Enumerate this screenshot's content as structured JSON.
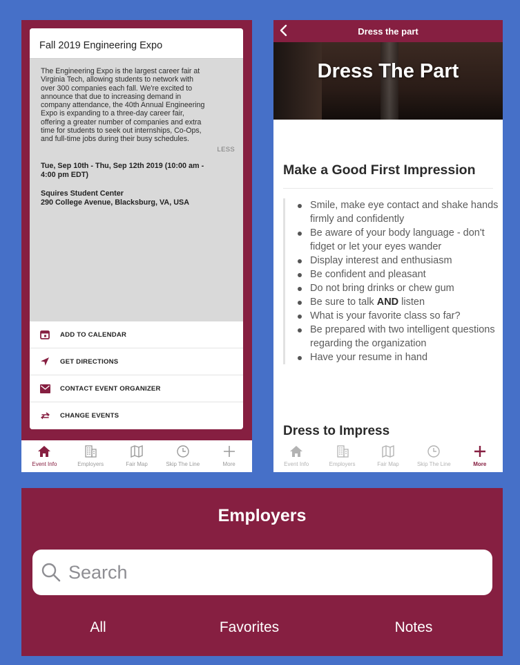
{
  "colors": {
    "brand_maroon": "#861f41",
    "background_blue": "#4670c8"
  },
  "left_screen": {
    "event_title": "Fall 2019 Engineering Expo",
    "description_lines": [
      "The Engineering Expo is the largest career fair at",
      "Virginia Tech, allowing students to network with",
      "over 300 companies each fall. We're excited to",
      "announce that due to increasing demand in",
      "company attendance, the 40th Annual Engineering",
      "Expo is expanding to a three-day career fair,",
      "offering a greater number of companies and extra",
      "time for students to seek out internships, Co-Ops,",
      "and full-time jobs during their busy schedules."
    ],
    "less_label": "LESS",
    "date_lines": [
      "Tue, Sep 10th - Thu, Sep 12th 2019 (10:00 am -",
      "4:00 pm EDT)"
    ],
    "location_name": "Squires Student Center",
    "location_address": "290 College Avenue, Blacksburg, VA, USA",
    "actions": [
      {
        "label": "ADD TO CALENDAR",
        "icon": "calendar-icon"
      },
      {
        "label": "GET DIRECTIONS",
        "icon": "location-arrow-icon"
      },
      {
        "label": "CONTACT EVENT ORGANIZER",
        "icon": "envelope-icon"
      },
      {
        "label": "CHANGE EVENTS",
        "icon": "swap-arrows-icon"
      }
    ],
    "tabs": [
      {
        "label": "Event Info",
        "icon": "home-icon",
        "active": true
      },
      {
        "label": "Employers",
        "icon": "building-icon",
        "active": false
      },
      {
        "label": "Fair Map",
        "icon": "map-icon",
        "active": false
      },
      {
        "label": "Skip The Line",
        "icon": "clock-icon",
        "active": false
      },
      {
        "label": "More",
        "icon": "plus-icon",
        "active": false
      }
    ]
  },
  "right_screen": {
    "nav_title": "Dress the part",
    "hero_title": "Dress The Part",
    "section1_title": "Make a Good First Impression",
    "tips": [
      {
        "text": "Smile, make eye contact and shake hands firmly and confidently"
      },
      {
        "text": "Be aware of your body language - don't fidget or let your eyes wander"
      },
      {
        "text": "Display interest and enthusiasm"
      },
      {
        "text": "Be confident and pleasant"
      },
      {
        "text": "Do not bring drinks or chew gum"
      },
      {
        "pre": "Be sure to talk ",
        "bold": "AND",
        "post": " listen"
      },
      {
        "text": "What is your favorite class so far?"
      },
      {
        "text": "Be prepared with two intelligent questions regarding the organization"
      },
      {
        "text": "Have your resume in hand"
      }
    ],
    "section2_title": "Dress to Impress",
    "tabs": [
      {
        "label": "Event Info",
        "icon": "home-icon",
        "active": false
      },
      {
        "label": "Employers",
        "icon": "building-icon",
        "active": false
      },
      {
        "label": "Fair Map",
        "icon": "map-icon",
        "active": false
      },
      {
        "label": "Skip The Line",
        "icon": "clock-icon",
        "active": false
      },
      {
        "label": "More",
        "icon": "plus-icon",
        "active": true
      }
    ]
  },
  "employers_screen": {
    "title": "Employers",
    "search_placeholder": "Search",
    "filters": [
      "All",
      "Favorites",
      "Notes"
    ]
  }
}
